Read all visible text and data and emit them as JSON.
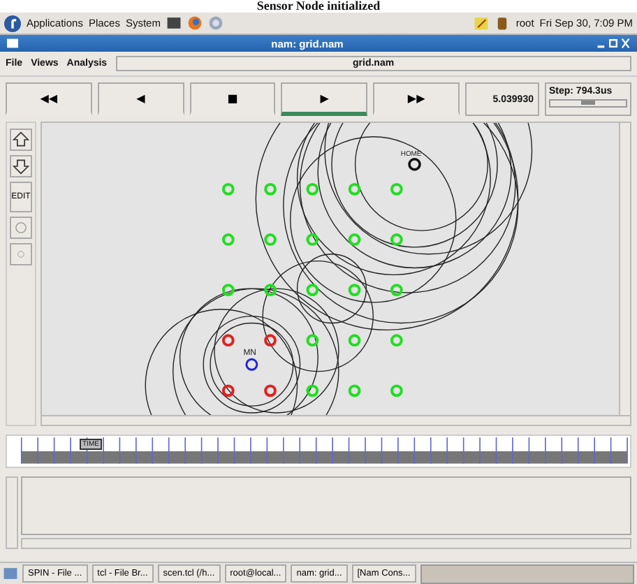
{
  "caption": "Sensor Node initialized",
  "top_panel": {
    "menus": [
      "Applications",
      "Places",
      "System"
    ],
    "user": "root",
    "clock": "Fri Sep 30, 7:09 PM"
  },
  "window": {
    "title": "nam: grid.nam"
  },
  "menu": [
    "File",
    "Views",
    "Analysis"
  ],
  "file_field": "grid.nam",
  "controls": [
    {
      "label": "◀◀",
      "selected": false
    },
    {
      "label": "◀",
      "selected": false
    },
    {
      "label": "■",
      "selected": false
    },
    {
      "label": "▶",
      "selected": true
    },
    {
      "label": "▶▶",
      "selected": false
    }
  ],
  "time": "5.039930",
  "step": {
    "label": "Step: 794.3us",
    "level": 0.5
  },
  "side_tools": {
    "edit": "EDIT"
  },
  "node_rows": [
    [
      {
        "color": "#22dd22"
      },
      {
        "color": "#22dd22"
      },
      {
        "color": "#22dd22"
      },
      {
        "color": "#22dd22"
      },
      {
        "color": "#22dd22"
      }
    ],
    [
      {
        "color": "#22dd22"
      },
      {
        "color": "#22dd22"
      },
      {
        "color": "#22dd22"
      },
      {
        "color": "#22dd22"
      },
      {
        "color": "#22dd22"
      }
    ],
    [
      {
        "color": "#22dd22"
      },
      {
        "color": "#22dd22"
      },
      {
        "color": "#22dd22"
      },
      {
        "color": "#22dd22"
      },
      {
        "color": "#22dd22"
      }
    ],
    [
      {
        "color": "#dd2222"
      },
      {
        "color": "#dd2222"
      },
      {
        "color": "#22dd22"
      },
      {
        "color": "#22dd22"
      },
      {
        "color": "#22dd22"
      }
    ],
    [
      {
        "color": "#dd2222"
      },
      {
        "color": "#dd2222"
      },
      {
        "color": "#22dd22"
      },
      {
        "color": "#22dd22"
      },
      {
        "color": "#22dd22"
      }
    ]
  ],
  "mobile_node": {
    "label": "MN",
    "color": "#2222dd"
  },
  "home_node": {
    "label": "HOME",
    "color": "#111111"
  },
  "timeline": {
    "marker": "TIME"
  },
  "taskbar": [
    "SPIN - File ...",
    "tcl - File Br...",
    "scen.tcl (/h...",
    "root@local...",
    "nam: grid...",
    "[Nam Cons..."
  ]
}
